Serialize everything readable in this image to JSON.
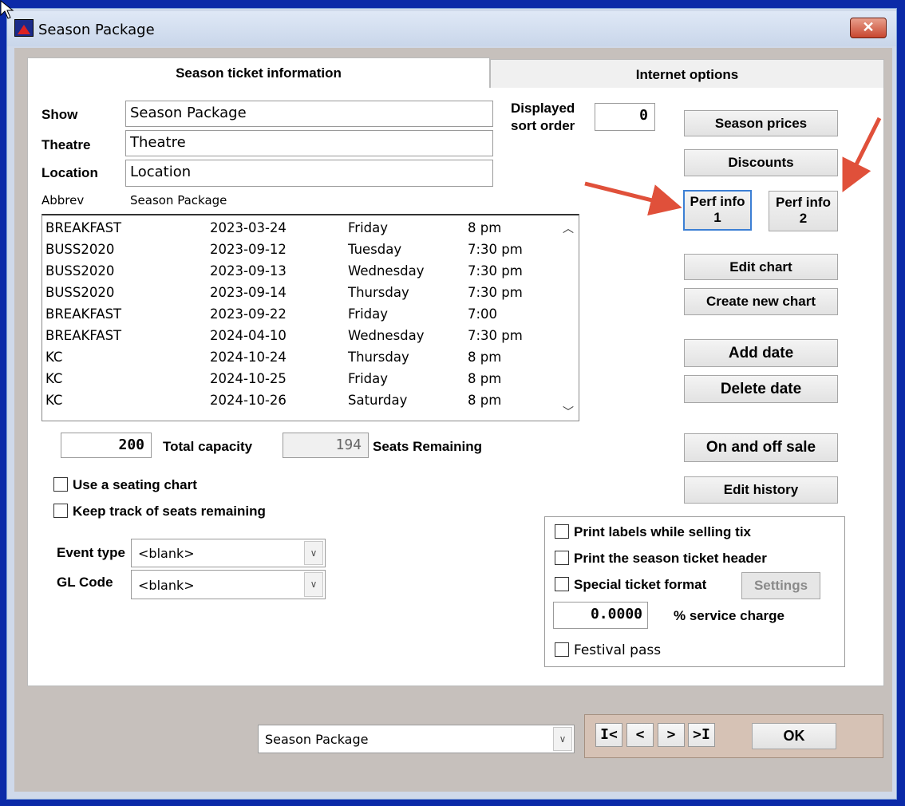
{
  "window": {
    "title": "Season Package",
    "close_label": "✕"
  },
  "tabs": [
    {
      "label": "Season ticket information",
      "active": true
    },
    {
      "label": "Internet options",
      "active": false
    }
  ],
  "form": {
    "show_label": "Show",
    "show_value": "Season Package",
    "theatre_label": "Theatre",
    "theatre_value": "Theatre",
    "location_label": "Location",
    "location_value": "Location",
    "abbrev_label": "Abbrev",
    "abbrev_value": "Season Package",
    "sort_label_1": "Displayed",
    "sort_label_2": "sort order",
    "sort_value": "0"
  },
  "performances": [
    {
      "code": "BREAKFAST",
      "date": "2023-03-24",
      "day": "Friday",
      "time": "8 pm"
    },
    {
      "code": "BUSS2020",
      "date": "2023-09-12",
      "day": "Tuesday",
      "time": "7:30 pm"
    },
    {
      "code": "BUSS2020",
      "date": "2023-09-13",
      "day": "Wednesday",
      "time": "7:30 pm"
    },
    {
      "code": "BUSS2020",
      "date": "2023-09-14",
      "day": "Thursday",
      "time": "7:30 pm"
    },
    {
      "code": "BREAKFAST",
      "date": "2023-09-22",
      "day": "Friday",
      "time": "7:00"
    },
    {
      "code": "BREAKFAST",
      "date": "2024-04-10",
      "day": "Wednesday",
      "time": "7:30 pm"
    },
    {
      "code": "KC",
      "date": "2024-10-24",
      "day": "Thursday",
      "time": "8 pm"
    },
    {
      "code": "KC",
      "date": "2024-10-25",
      "day": "Friday",
      "time": "8 pm"
    },
    {
      "code": "KC",
      "date": "2024-10-26",
      "day": "Saturday",
      "time": "8 pm"
    }
  ],
  "capacity": {
    "total_value": "200",
    "total_label": "Total capacity",
    "remaining_value": "194",
    "remaining_label": "Seats Remaining"
  },
  "options": {
    "use_seating_chart": "Use a seating chart",
    "keep_track": "Keep track of seats remaining",
    "event_type_label": "Event type",
    "event_type_value": "<blank>",
    "gl_code_label": "GL Code",
    "gl_code_value": "<blank>"
  },
  "buttons": {
    "season_prices": "Season prices",
    "discounts": "Discounts",
    "perf_info_1_line1": "Perf info",
    "perf_info_1_line2": "1",
    "perf_info_2_line1": "Perf info",
    "perf_info_2_line2": "2",
    "edit_chart": "Edit chart",
    "create_new_chart": "Create new chart",
    "add_date": "Add  date",
    "delete_date": "Delete date",
    "on_off_sale": "On and off sale",
    "edit_history": "Edit history"
  },
  "print_group": {
    "print_labels": "Print labels while selling tix",
    "print_header": "Print the season ticket header",
    "special_format": "Special ticket format",
    "settings": "Settings",
    "service_charge_value": "0.0000",
    "service_charge_label": "% service charge",
    "festival_pass": "Festival pass"
  },
  "footer": {
    "package_select_value": "Season Package",
    "nav_first": "I<",
    "nav_prev": "<",
    "nav_next": ">",
    "nav_last": ">I",
    "ok": "OK"
  },
  "colors": {
    "annotation_arrow": "#e0503a",
    "focus_border": "#3c7fd4"
  }
}
